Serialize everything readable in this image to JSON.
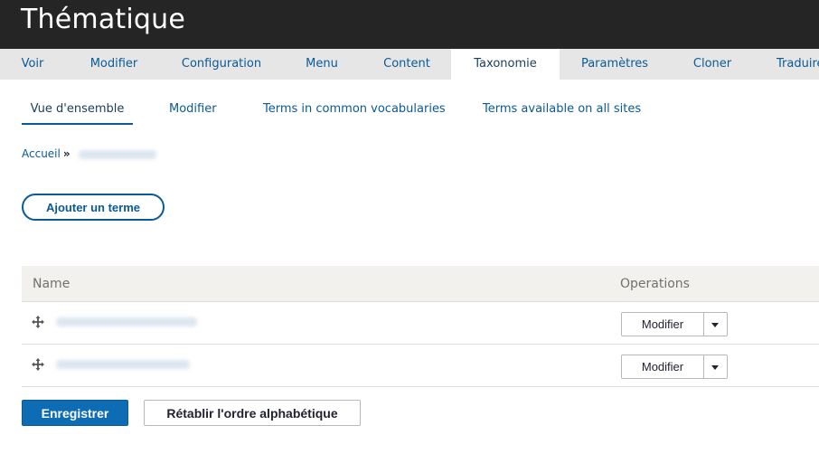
{
  "header": {
    "title": "Thématique"
  },
  "primary_tabs": [
    {
      "label": "Voir",
      "active": false
    },
    {
      "label": "Modifier",
      "active": false
    },
    {
      "label": "Configuration",
      "active": false
    },
    {
      "label": "Menu",
      "active": false
    },
    {
      "label": "Content",
      "active": false
    },
    {
      "label": "Taxonomie",
      "active": true
    },
    {
      "label": "Paramètres",
      "active": false
    },
    {
      "label": "Cloner",
      "active": false
    },
    {
      "label": "Traduire",
      "active": false
    }
  ],
  "secondary_tabs": [
    {
      "label": "Vue d'ensemble",
      "active": true
    },
    {
      "label": "Modifier",
      "active": false
    },
    {
      "label": "Terms in common vocabularies",
      "active": false
    },
    {
      "label": "Terms available on all sites",
      "active": false
    }
  ],
  "breadcrumb": {
    "home": "Accueil",
    "separator": "»"
  },
  "actions": {
    "add_term": "Ajouter un terme"
  },
  "table": {
    "headers": {
      "name": "Name",
      "operations": "Operations"
    },
    "rows": [
      {
        "operation_label": "Modifier"
      },
      {
        "operation_label": "Modifier"
      }
    ]
  },
  "footer": {
    "save": "Enregistrer",
    "reset": "Rétablir l'ordre alphabétique"
  },
  "icons": {
    "drag": "drag-handle-icon",
    "dropdown": "chevron-down-icon"
  },
  "colors": {
    "header_bg": "#252525",
    "link": "#0a5a96",
    "primary_button": "#0e6cb5"
  }
}
